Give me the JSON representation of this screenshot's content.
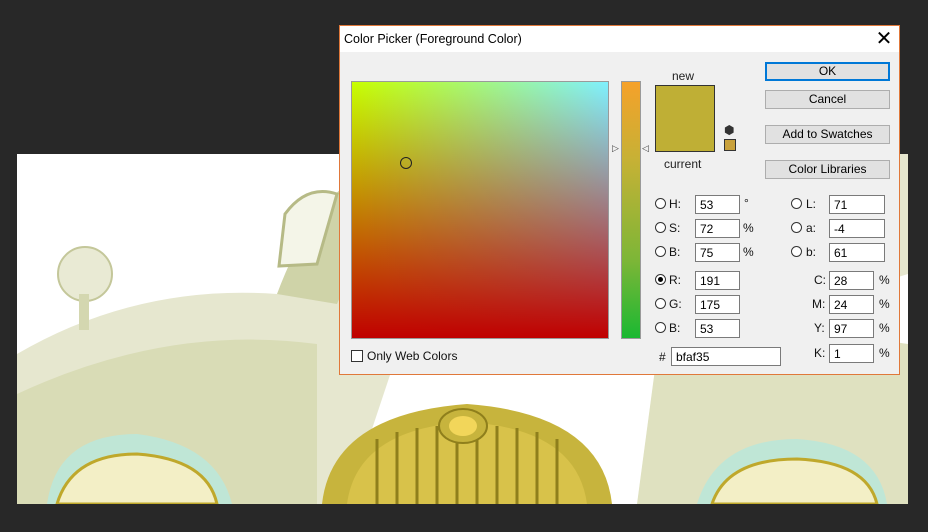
{
  "dialog": {
    "title": "Color Picker (Foreground Color)",
    "swatch_new_label": "new",
    "swatch_current_label": "current",
    "new_color": "#bfaf35",
    "current_color": "#bfaf35",
    "buttons": {
      "ok": "OK",
      "cancel": "Cancel",
      "add_to_swatches": "Add to Swatches",
      "color_libraries": "Color Libraries"
    },
    "hsb": {
      "h_label": "H:",
      "h_value": "53",
      "h_unit": "°",
      "s_label": "S:",
      "s_value": "72",
      "s_unit": "%",
      "b_label": "B:",
      "b_value": "75",
      "b_unit": "%"
    },
    "rgb": {
      "r_label": "R:",
      "r_value": "191",
      "g_label": "G:",
      "g_value": "175",
      "b_label": "B:",
      "b_value": "53"
    },
    "lab": {
      "l_label": "L:",
      "l_value": "71",
      "a_label": "a:",
      "a_value": "-4",
      "b_label": "b:",
      "b_value": "61"
    },
    "cmyk": {
      "c_label": "C:",
      "c_value": "28",
      "m_label": "M:",
      "m_value": "24",
      "y_label": "Y:",
      "y_value": "97",
      "k_label": "K:",
      "k_value": "1",
      "unit": "%"
    },
    "hex_label": "#",
    "hex_value": "bfaf35",
    "only_web_colors_label": "Only Web Colors",
    "selected_mode": "R"
  },
  "icons": {
    "close": "close-icon",
    "cube": "web-safe-cube-icon"
  }
}
